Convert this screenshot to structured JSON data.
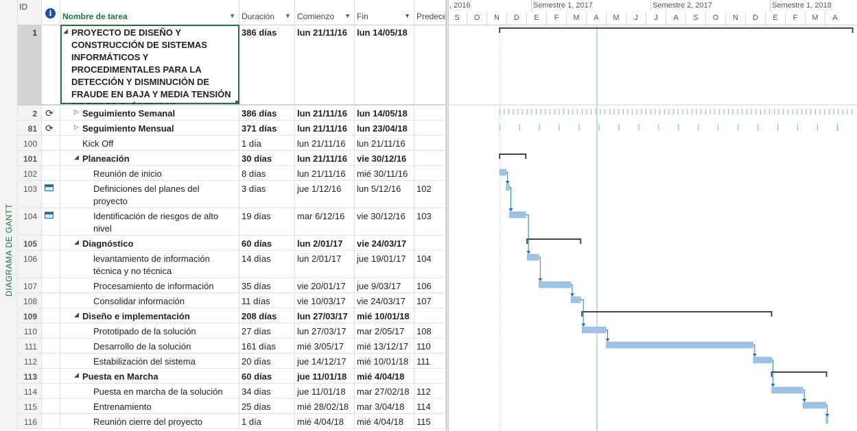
{
  "sidebar": {
    "view_label": "DIAGRAMA DE GANTT"
  },
  "columns": {
    "id": "ID",
    "name": "Nombre de tarea",
    "duration": "Duración",
    "start": "Comienzo",
    "end": "Fin",
    "pred": "Predece"
  },
  "timescale": {
    "periods": [
      ", 2016",
      "Semestre 1, 2017",
      "Semestre 2, 2017",
      "Semestre 1, 2018"
    ],
    "months": [
      "S",
      "O",
      "N",
      "D",
      "E",
      "F",
      "M",
      "A",
      "M",
      "J",
      "J",
      "A",
      "S",
      "O",
      "N",
      "D",
      "E",
      "F",
      "M",
      "A"
    ]
  },
  "tasks": [
    {
      "id": "1",
      "name": "PROYECTO DE DISEÑO Y CONSTRUCCIÓN DE SISTEMAS INFORMÁTICOS Y PROCEDIMENTALES PARA LA DETECCIÓN Y DISMINUCIÓN DE FRAUDE EN BAJA Y MEDIA TENSIÓN DE REDES ELÉCTRICAS",
      "dur": "386 días",
      "start": "lun 21/11/16",
      "end": "lun 14/05/18",
      "pred": "",
      "level": 0,
      "bold": true,
      "toggle": "expanded",
      "indicator": "",
      "selected": true
    },
    {
      "id": "2",
      "name": "Seguimiento Semanal",
      "dur": "386 días",
      "start": "lun 21/11/16",
      "end": "lun 14/05/18",
      "pred": "",
      "level": 1,
      "bold": true,
      "toggle": "collapsed",
      "indicator": "recurring-icon"
    },
    {
      "id": "81",
      "name": "Seguimiento Mensual",
      "dur": "371 días",
      "start": "lun 21/11/16",
      "end": "lun 23/04/18",
      "pred": "",
      "level": 1,
      "bold": true,
      "toggle": "collapsed",
      "indicator": "recurring-icon"
    },
    {
      "id": "100",
      "name": "Kick Off",
      "dur": "1 día",
      "start": "lun 21/11/16",
      "end": "lun 21/11/16",
      "pred": "",
      "level": 1,
      "bold": false,
      "toggle": "",
      "indicator": ""
    },
    {
      "id": "101",
      "name": "Planeación",
      "dur": "30 días",
      "start": "lun 21/11/16",
      "end": "vie 30/12/16",
      "pred": "",
      "level": 1,
      "bold": true,
      "toggle": "expanded",
      "indicator": ""
    },
    {
      "id": "102",
      "name": "Reunión de inicio",
      "dur": "8 días",
      "start": "lun 21/11/16",
      "end": "mié 30/11/16",
      "pred": "",
      "level": 2,
      "bold": false,
      "toggle": "",
      "indicator": ""
    },
    {
      "id": "103",
      "name": "Definiciones del planes del proyecto",
      "dur": "3 días",
      "start": "jue 1/12/16",
      "end": "lun 5/12/16",
      "pred": "102",
      "level": 2,
      "bold": false,
      "toggle": "",
      "indicator": "calendar-icon"
    },
    {
      "id": "104",
      "name": "Identificación de riesgos de alto nivel",
      "dur": "19 días",
      "start": "mar 6/12/16",
      "end": "vie 30/12/16",
      "pred": "103",
      "level": 2,
      "bold": false,
      "toggle": "",
      "indicator": "calendar-icon"
    },
    {
      "id": "105",
      "name": "Diagnóstico",
      "dur": "60 días",
      "start": "lun 2/01/17",
      "end": "vie 24/03/17",
      "pred": "",
      "level": 1,
      "bold": true,
      "toggle": "expanded",
      "indicator": ""
    },
    {
      "id": "106",
      "name": "levantamiento de información técnica y no técnica",
      "dur": "14 días",
      "start": "lun 2/01/17",
      "end": "jue 19/01/17",
      "pred": "104",
      "level": 2,
      "bold": false,
      "toggle": "",
      "indicator": ""
    },
    {
      "id": "107",
      "name": "Procesamiento de información",
      "dur": "35 días",
      "start": "vie 20/01/17",
      "end": "jue 9/03/17",
      "pred": "106",
      "level": 2,
      "bold": false,
      "toggle": "",
      "indicator": ""
    },
    {
      "id": "108",
      "name": "Consolidar información",
      "dur": "11 días",
      "start": "vie 10/03/17",
      "end": "vie 24/03/17",
      "pred": "107",
      "level": 2,
      "bold": false,
      "toggle": "",
      "indicator": ""
    },
    {
      "id": "109",
      "name": "Diseño e implementación",
      "dur": "208 días",
      "start": "lun 27/03/17",
      "end": "mié 10/01/18",
      "pred": "",
      "level": 1,
      "bold": true,
      "toggle": "expanded",
      "indicator": ""
    },
    {
      "id": "110",
      "name": "Prototipado de la solución",
      "dur": "27 días",
      "start": "lun 27/03/17",
      "end": "mar 2/05/17",
      "pred": "108",
      "level": 2,
      "bold": false,
      "toggle": "",
      "indicator": ""
    },
    {
      "id": "111",
      "name": "Desarrollo de la solución",
      "dur": "161 días",
      "start": "mié 3/05/17",
      "end": "mié 13/12/17",
      "pred": "110",
      "level": 2,
      "bold": false,
      "toggle": "",
      "indicator": ""
    },
    {
      "id": "112",
      "name": "Estabilización del sistema",
      "dur": "20 días",
      "start": "jue 14/12/17",
      "end": "mié 10/01/18",
      "pred": "111",
      "level": 2,
      "bold": false,
      "toggle": "",
      "indicator": ""
    },
    {
      "id": "113",
      "name": "Puesta en Marcha",
      "dur": "60 días",
      "start": "jue 11/01/18",
      "end": "mié 4/04/18",
      "pred": "",
      "level": 1,
      "bold": true,
      "toggle": "expanded",
      "indicator": ""
    },
    {
      "id": "114",
      "name": "Puesta en marcha de la solución",
      "dur": "34 días",
      "start": "jue 11/01/18",
      "end": "mar 27/02/18",
      "pred": "112",
      "level": 2,
      "bold": false,
      "toggle": "",
      "indicator": ""
    },
    {
      "id": "115",
      "name": "Entrenamiento",
      "dur": "25 días",
      "start": "mié 28/02/18",
      "end": "mar 3/04/18",
      "pred": "114",
      "level": 2,
      "bold": false,
      "toggle": "",
      "indicator": ""
    },
    {
      "id": "116",
      "name": "Reunión cierre del proyecto",
      "dur": "1 día",
      "start": "mié 4/04/18",
      "end": "mié 4/04/18",
      "pred": "115",
      "level": 2,
      "bold": false,
      "toggle": "",
      "indicator": ""
    }
  ],
  "colors": {
    "accent": "#217346",
    "bar": "#9dc3e6",
    "summary": "#444444",
    "link": "#2e75b6",
    "today": "#8fbf8f"
  }
}
